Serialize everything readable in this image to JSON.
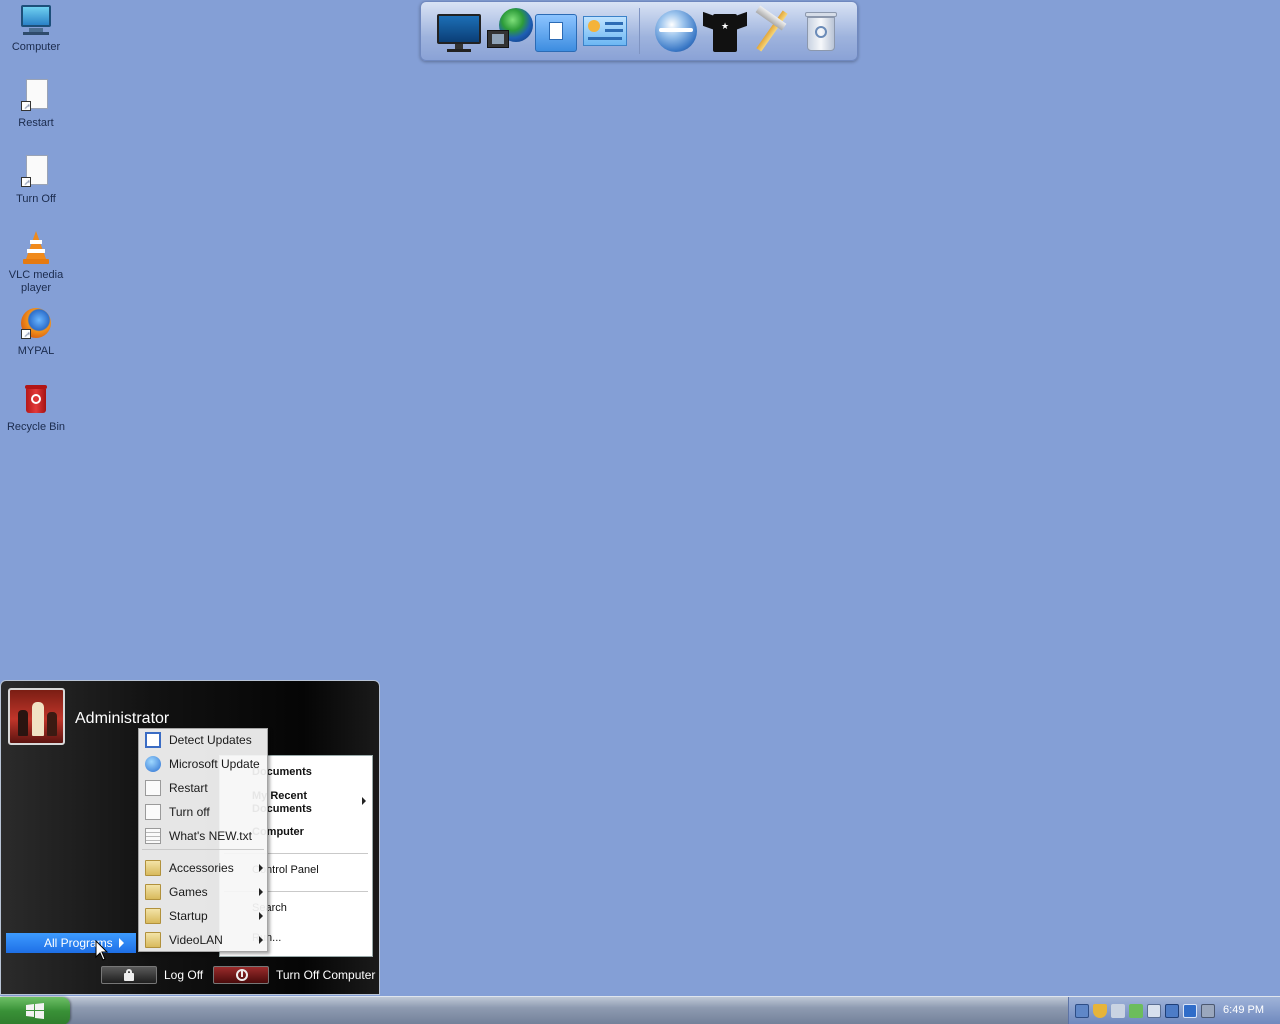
{
  "desktop": {
    "icons": [
      {
        "label": "Computer",
        "icon": "computer-icon"
      },
      {
        "label": "Restart",
        "icon": "shortcut-file-icon"
      },
      {
        "label": "Turn Off",
        "icon": "shortcut-file-icon"
      },
      {
        "label": "VLC media player",
        "icon": "vlc-cone-icon"
      },
      {
        "label": "MYPAL",
        "icon": "firefox-icon"
      },
      {
        "label": "Recycle Bin",
        "icon": "recycle-bin-icon"
      }
    ]
  },
  "dock": {
    "items": [
      "monitor-icon",
      "network-globe-icon",
      "documents-folder-icon",
      "control-panel-icon",
      "browser-globe-icon",
      "tshirt-icon",
      "tools-icon",
      "trash-icon"
    ]
  },
  "start_menu": {
    "user_name": "Administrator",
    "right_items": {
      "documents": "Documents",
      "recent_documents_a": "My Recent",
      "recent_documents_b": "Documents",
      "computer": "Computer",
      "control_panel": "Control Panel",
      "search": "Search",
      "run": "Run..."
    },
    "all_programs": "All Programs",
    "log_off": "Log Off",
    "turn_off": "Turn Off Computer"
  },
  "programs_submenu": {
    "items": [
      {
        "label": "Detect Updates",
        "icon": "window-icon"
      },
      {
        "label": "Microsoft Update",
        "icon": "update-globe-icon"
      },
      {
        "label": "Restart",
        "icon": "page-icon"
      },
      {
        "label": "Turn off",
        "icon": "page-icon"
      },
      {
        "label": "What's NEW.txt",
        "icon": "text-file-icon"
      },
      {
        "label": "Accessories",
        "icon": "folder-icon",
        "has_submenu": true
      },
      {
        "label": "Games",
        "icon": "folder-icon",
        "has_submenu": true
      },
      {
        "label": "Startup",
        "icon": "folder-icon",
        "has_submenu": true
      },
      {
        "label": "VideoLAN",
        "icon": "folder-icon",
        "has_submenu": true
      }
    ]
  },
  "taskbar": {
    "clock": "6:49 PM",
    "tray_icons": [
      "network-icon",
      "shield-icon",
      "volume-icon",
      "safely-remove-icon",
      "display-icon",
      "monitor-tray-icon",
      "language-icon",
      "keyboard-icon"
    ]
  }
}
